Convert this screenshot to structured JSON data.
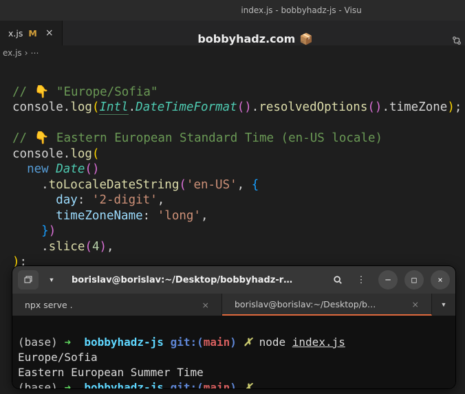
{
  "window": {
    "title": "index.js - bobbyhadz-js - Visu"
  },
  "site": {
    "name": "bobbyhadz.com",
    "icon": "📦"
  },
  "tab": {
    "name": "x.js",
    "modified": "M"
  },
  "breadcrumb": {
    "file": "ex.js",
    "sep": "›",
    "more": "⋯"
  },
  "code": {
    "c1": "// 👇 \"Europe/Sofia\"",
    "console": "console",
    "dot": ".",
    "log": "log",
    "intl": "Intl",
    "dtf": "DateTimeFormat",
    "resolved": "resolvedOptions",
    "tz": "timeZone",
    "c2": "// 👇 Eastern European Standard Time (en-US locale)",
    "new": "new",
    "date": "Date",
    "toLocale": "toLocaleDateString",
    "locale": "'en-US'",
    "day": "day",
    "dayVal": "'2-digit'",
    "tzName": "timeZoneName",
    "tzVal": "'long'",
    "slice": "slice",
    "sliceArg": "4",
    "comma": ",",
    "semi": ";"
  },
  "terminal": {
    "titleBar": {
      "title": "borislav@borislav:~/Desktop/bobbyhadz-r…"
    },
    "tabs": [
      {
        "label": "npx serve .",
        "active": false
      },
      {
        "label": "borislav@borislav:~/Desktop/b…",
        "active": true
      }
    ],
    "lines": {
      "base": "(base)",
      "arrow": "➜",
      "dir": "bobbyhadz-js",
      "git": "git:",
      "lp": "(",
      "branch": "main",
      "rp": ")",
      "x": "✗",
      "node": "node",
      "file": "index.js",
      "out1": "Europe/Sofia",
      "out2": "Eastern European Summer Time"
    }
  }
}
